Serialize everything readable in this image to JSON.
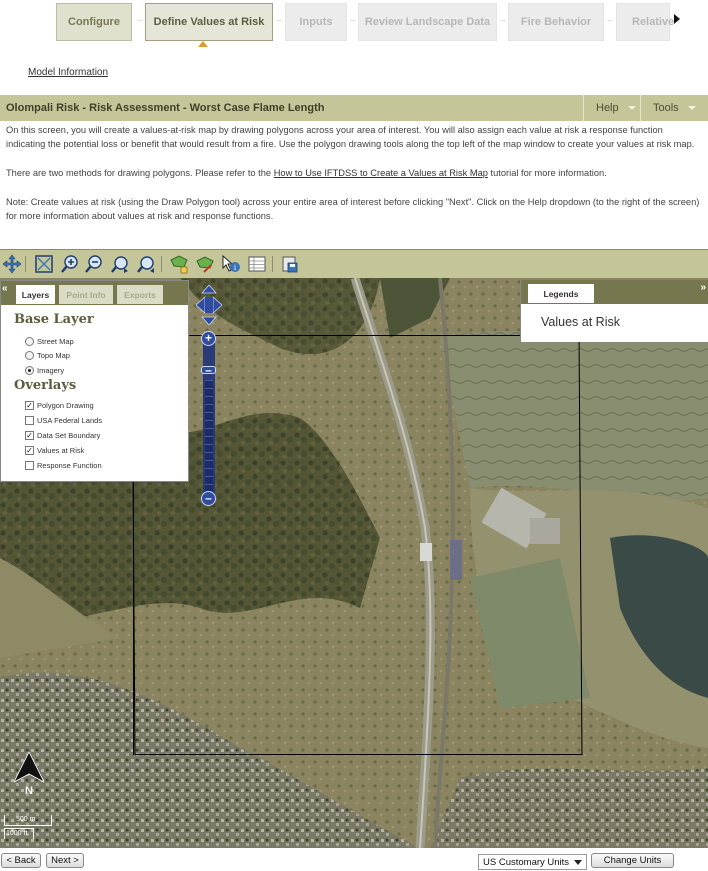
{
  "wizard": {
    "steps": [
      {
        "label": "Configure",
        "state": "done"
      },
      {
        "label": "Define Values at Risk",
        "state": "active"
      },
      {
        "label": "Inputs",
        "state": "pending"
      },
      {
        "label": "Review Landscape Data",
        "state": "pending"
      },
      {
        "label": "Fire Behavior",
        "state": "pending"
      },
      {
        "label": "Relative",
        "state": "pending"
      }
    ],
    "separator": "-- ➔"
  },
  "model_link": "Model Information",
  "header": {
    "title": "Olompali Risk - Risk Assessment - Worst Case Flame Length",
    "help": "Help",
    "tools": "Tools"
  },
  "intro": {
    "p1": "On this screen, you will create a values-at-risk map by drawing polygons across your area of interest. You will also assign each value at risk a response function indicating the potential loss or benefit that would result from a fire. Use the polygon drawing tools along the top left of the map window to create your values at risk map.",
    "p2_before": "There are two methods for drawing polygons. Please refer to the ",
    "p2_link": "How to Use IFTDSS to Create a Values at Risk Map",
    "p2_after": " tutorial for more information.",
    "p3": "Note: Create values at risk (using the Draw Polygon tool) across your entire area of interest before clicking \"Next\". Click on the Help dropdown (to the right of the screen) for more information about values at risk and response functions."
  },
  "map_toolbar": {
    "tools": [
      "pan-icon",
      "zoom-extent-icon",
      "zoom-in-icon",
      "zoom-out-icon",
      "zoom-previous-icon",
      "zoom-next-icon",
      "draw-polygon-icon",
      "edit-polygon-icon",
      "identify-icon",
      "table-icon",
      "save-map-icon"
    ]
  },
  "layers_panel": {
    "tabs": [
      "Layers",
      "Point Info",
      "Exports"
    ],
    "base_layer_heading": "Base Layer",
    "base_layers": [
      {
        "label": "Street Map",
        "selected": false
      },
      {
        "label": "Topo Map",
        "selected": false
      },
      {
        "label": "Imagery",
        "selected": true
      }
    ],
    "overlays_heading": "Overlays",
    "overlays": [
      {
        "label": "Polygon Drawing",
        "checked": true
      },
      {
        "label": "USA Federal Lands",
        "checked": false
      },
      {
        "label": "Data Set Boundary",
        "checked": true
      },
      {
        "label": "Values at Risk",
        "checked": true
      },
      {
        "label": "Response Function",
        "checked": false
      }
    ]
  },
  "legend_panel": {
    "tab": "Legends",
    "title": "Values at Risk"
  },
  "map": {
    "north_label": "N",
    "scale_top": "500 m",
    "scale_bottom": "1000 ft"
  },
  "footer": {
    "back": "< Back",
    "next": "Next >",
    "units_selected": "US Customary Units",
    "change_units": "Change Units"
  },
  "colors": {
    "accent": "#c4c699",
    "panel_tab": "#76774f",
    "active_marker": "#e19a2e",
    "zoom_control": "#2f4c9e"
  }
}
